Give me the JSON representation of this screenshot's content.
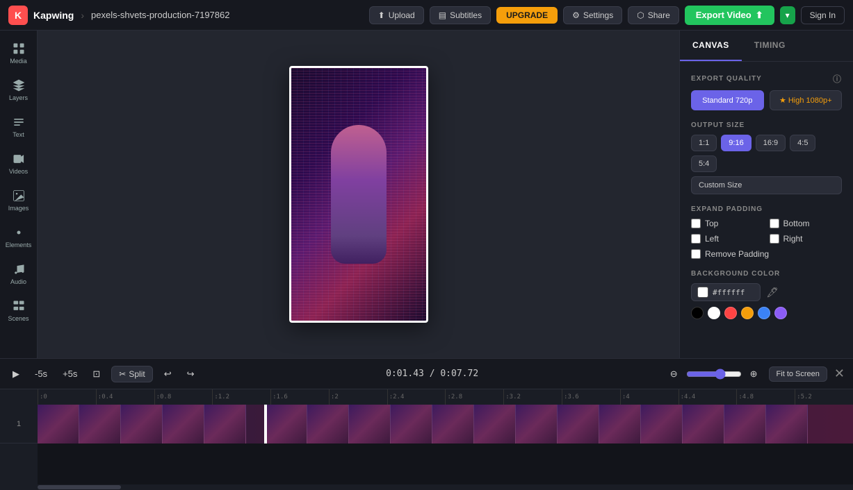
{
  "topbar": {
    "logo": "K",
    "brand": "Kapwing",
    "separator": "›",
    "project": "pexels-shvets-production-7197862",
    "upload_label": "Upload",
    "subtitles_label": "Subtitles",
    "upgrade_label": "UPGRADE",
    "settings_label": "Settings",
    "share_label": "Share",
    "export_label": "Export Video",
    "signin_label": "Sign In"
  },
  "sidebar": {
    "items": [
      {
        "label": "Media",
        "icon": "media-icon"
      },
      {
        "label": "Layers",
        "icon": "layers-icon"
      },
      {
        "label": "Text",
        "icon": "text-icon"
      },
      {
        "label": "Videos",
        "icon": "videos-icon"
      },
      {
        "label": "Images",
        "icon": "images-icon"
      },
      {
        "label": "Elements",
        "icon": "elements-icon"
      },
      {
        "label": "Audio",
        "icon": "audio-icon"
      },
      {
        "label": "Scenes",
        "icon": "scenes-icon"
      }
    ]
  },
  "right_panel": {
    "tabs": [
      {
        "label": "CANVAS",
        "active": true
      },
      {
        "label": "TIMING",
        "active": false
      }
    ],
    "export_quality": {
      "label": "EXPORT QUALITY",
      "options": [
        {
          "label": "Standard 720p",
          "active": true
        },
        {
          "label": "High 1080p+",
          "active": false,
          "premium": true
        }
      ]
    },
    "output_size": {
      "label": "OUTPUT SIZE",
      "ratios": [
        {
          "label": "1:1",
          "active": false
        },
        {
          "label": "9:16",
          "active": true
        },
        {
          "label": "16:9",
          "active": false
        },
        {
          "label": "4:5",
          "active": false
        },
        {
          "label": "5:4",
          "active": false
        }
      ],
      "custom_label": "Custom Size"
    },
    "expand_padding": {
      "label": "EXPAND PADDING",
      "options": [
        {
          "label": "Top",
          "checked": false
        },
        {
          "label": "Bottom",
          "checked": false
        },
        {
          "label": "Left",
          "checked": false
        },
        {
          "label": "Right",
          "checked": false
        },
        {
          "label": "Remove Padding",
          "checked": false
        }
      ]
    },
    "background_color": {
      "label": "BACKGROUND COLOR",
      "hex": "#ffffff",
      "presets": [
        "#000000",
        "#ffffff",
        "#ff4444",
        "#f59e0b",
        "#3b82f6",
        "#8b5cf6"
      ]
    }
  },
  "timeline": {
    "time_current": "0:01.43",
    "time_total": "0:07.72",
    "split_label": "Split",
    "fit_screen_label": "Fit to Screen",
    "ruler_marks": [
      ":0",
      ":0.4",
      ":0.8",
      ":1.2",
      ":1.6",
      ":2",
      ":2.4",
      ":2.8",
      ":3.2",
      ":3.6",
      ":4",
      ":4.4",
      ":4.8",
      ":5.2"
    ]
  }
}
